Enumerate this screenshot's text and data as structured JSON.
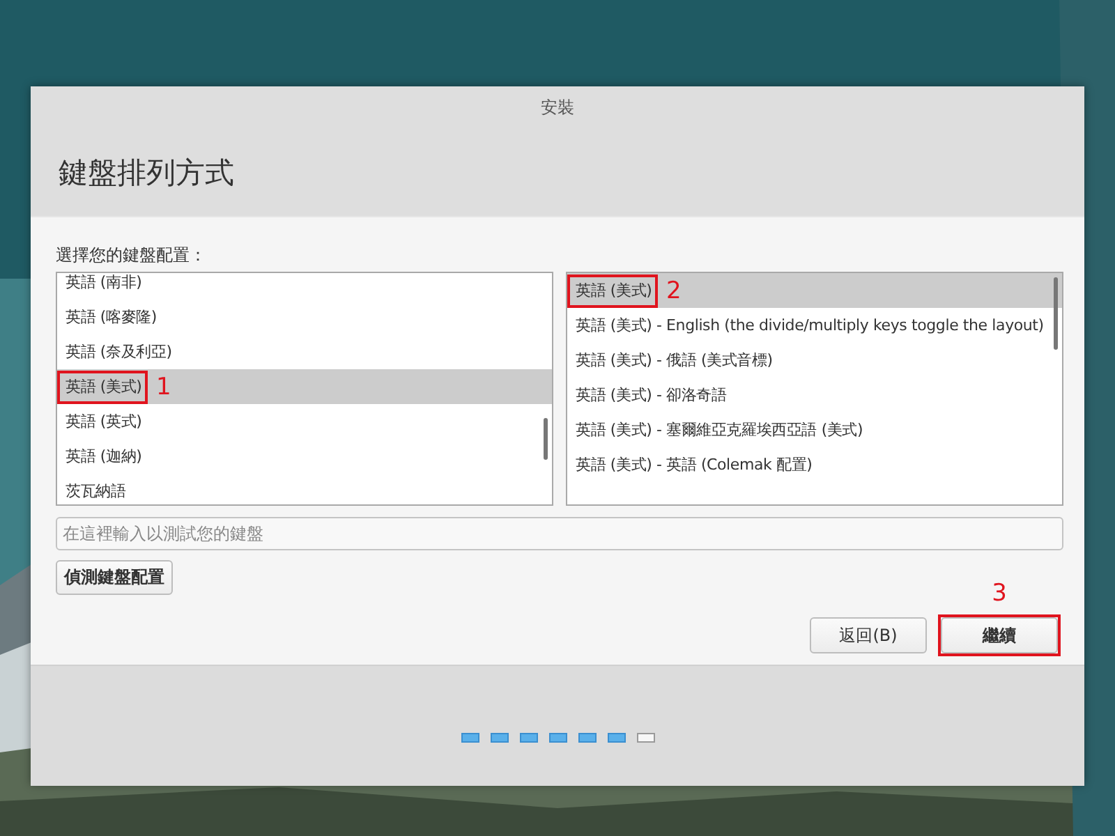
{
  "window": {
    "title": "安裝"
  },
  "header": {
    "title": "鍵盤排列方式"
  },
  "prompt": "選擇您的鍵盤配置：",
  "layouts": [
    {
      "label": "英語 (南非)",
      "selected": false
    },
    {
      "label": "英語 (喀麥隆)",
      "selected": false
    },
    {
      "label": "英語 (奈及利亞)",
      "selected": false
    },
    {
      "label": "英語 (美式)",
      "selected": true,
      "callout": "1"
    },
    {
      "label": "英語 (英式)",
      "selected": false
    },
    {
      "label": "英語 (迦納)",
      "selected": false
    },
    {
      "label": "茨瓦納語",
      "selected": false
    }
  ],
  "variants": [
    {
      "label": "英語 (美式)",
      "selected": true,
      "callout": "2"
    },
    {
      "label": "英語 (美式) - English (the divide/multiply keys toggle the layout)",
      "selected": false
    },
    {
      "label": "英語 (美式) - 俄語 (美式音標)",
      "selected": false
    },
    {
      "label": "英語 (美式) - 卻洛奇語",
      "selected": false
    },
    {
      "label": "英語 (美式) - 塞爾維亞克羅埃西亞語 (美式)",
      "selected": false
    },
    {
      "label": "英語 (美式) - 英語 (Colemak 配置)",
      "selected": false
    }
  ],
  "test_field": {
    "placeholder": "在這裡輸入以測試您的鍵盤"
  },
  "detect_button": "偵測鍵盤配置",
  "buttons": [
    {
      "label": "返回(B)",
      "kind": "normal"
    },
    {
      "label": "繼續",
      "kind": "normal",
      "callout": "3"
    }
  ],
  "progress": [
    {
      "done": true
    },
    {
      "done": true
    },
    {
      "done": true
    },
    {
      "done": true
    },
    {
      "done": true
    },
    {
      "done": true
    },
    {
      "done": false
    }
  ]
}
